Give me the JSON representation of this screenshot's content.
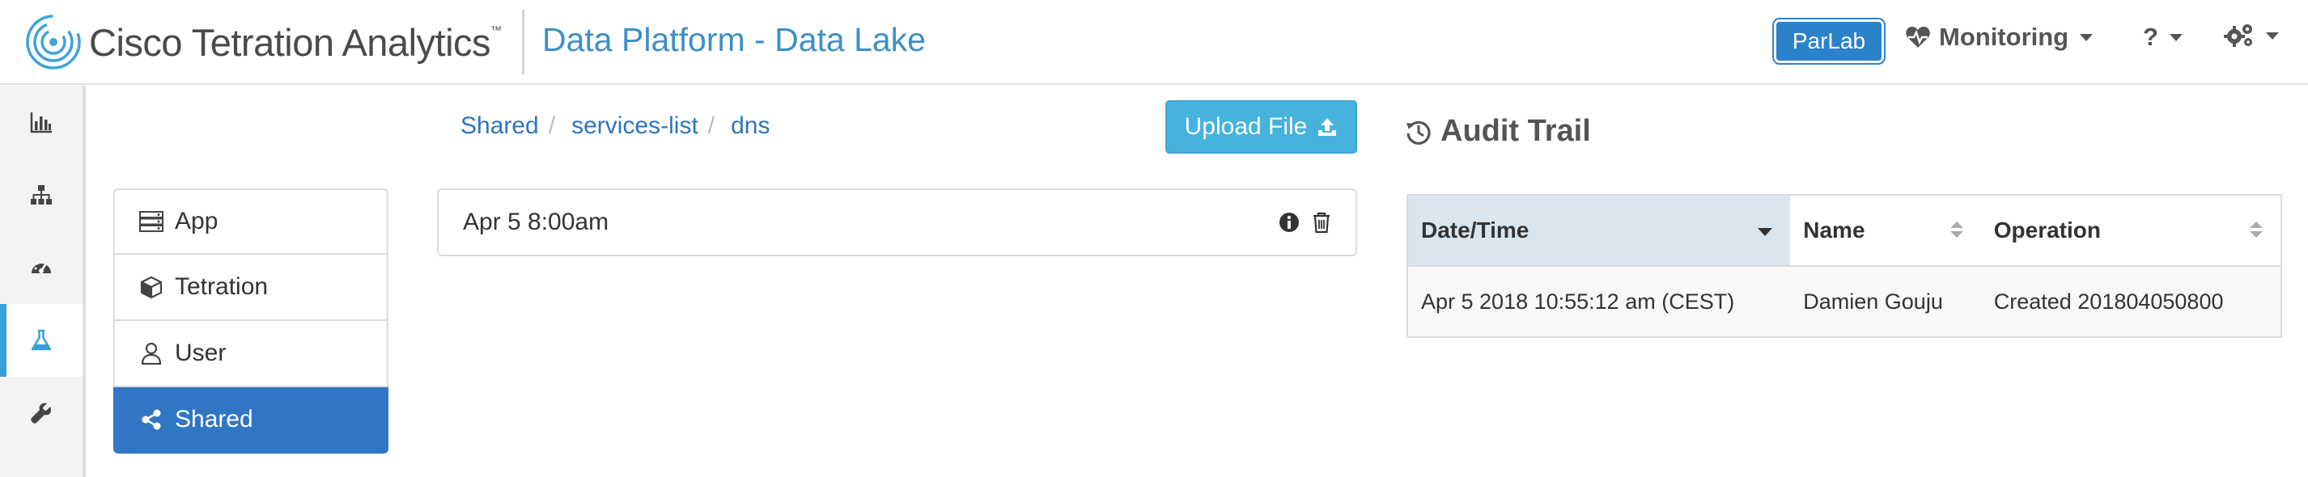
{
  "header": {
    "app_name": "Cisco Tetration Analytics",
    "trademark": "™",
    "page_title": "Data Platform - Data Lake",
    "tenant_label": "ParLab",
    "monitoring_label": "Monitoring",
    "help_label": "?"
  },
  "rail": {
    "items": [
      {
        "icon": "bar-chart-icon"
      },
      {
        "icon": "sitemap-icon"
      },
      {
        "icon": "dashboard-icon"
      },
      {
        "icon": "flask-icon",
        "active": true
      },
      {
        "icon": "wrench-icon"
      }
    ]
  },
  "folders": {
    "items": [
      {
        "label": "App",
        "icon": "server-icon"
      },
      {
        "label": "Tetration",
        "icon": "cube-icon"
      },
      {
        "label": "User",
        "icon": "user-icon"
      },
      {
        "label": "Shared",
        "icon": "share-icon",
        "active": true
      }
    ]
  },
  "breadcrumb": {
    "items": [
      "Shared",
      "services-list",
      "dns"
    ]
  },
  "upload_label": "Upload File",
  "files": {
    "items": [
      {
        "name": "Apr 5 8:00am"
      }
    ]
  },
  "audit": {
    "title": "Audit Trail",
    "columns": [
      "Date/Time",
      "Name",
      "Operation"
    ],
    "rows": [
      [
        "Apr 5 2018 10:55:12 am (CEST)",
        "Damien Gouju",
        "Created 201804050800"
      ]
    ]
  },
  "colors": {
    "accent": "#3d8fc6",
    "active_folder": "#3176c3",
    "upload_button": "#46b2de",
    "rail_active_bar": "#3a9fd6",
    "sorted_header": "#d9e6f0"
  }
}
